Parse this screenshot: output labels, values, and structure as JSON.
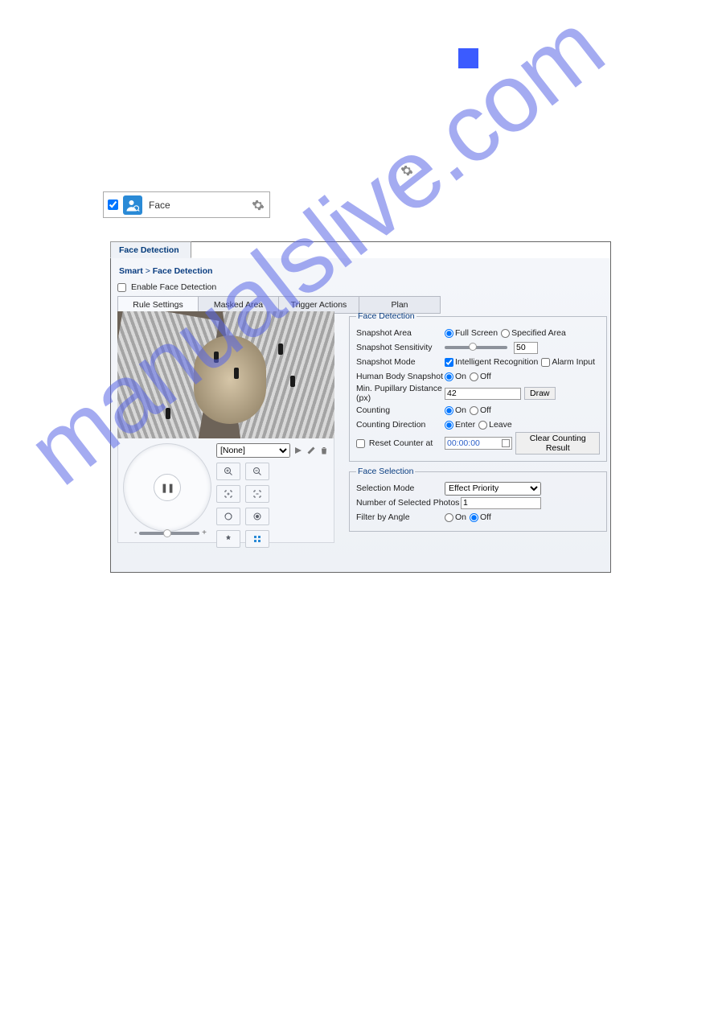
{
  "page_num_box": " ",
  "watermark": "manualslive.com",
  "face_bar": {
    "label": "Face"
  },
  "panel": {
    "tab_title": "Face Detection",
    "breadcrumb": {
      "smart": "Smart",
      "sep": ">",
      "current": "Face Detection"
    },
    "enable_label": "Enable Face Detection",
    "tabs": [
      "Rule Settings",
      "Masked Area",
      "Trigger Actions",
      "Plan"
    ]
  },
  "preset": {
    "selected": "[None]"
  },
  "zoom": {
    "minus": "-",
    "plus": "+"
  },
  "pause_glyph": "❚❚",
  "fd": {
    "legend": "Face Detection",
    "snapshot_area": {
      "label": "Snapshot Area",
      "full": "Full Screen",
      "spec": "Specified Area"
    },
    "sensitivity": {
      "label": "Snapshot Sensitivity",
      "value": "50"
    },
    "mode": {
      "label": "Snapshot Mode",
      "intel": "Intelligent Recognition",
      "alarm": "Alarm Input"
    },
    "human": {
      "label": "Human Body Snapshot",
      "on": "On",
      "off": "Off"
    },
    "pupillary": {
      "label": "Min. Pupillary Distance (px)",
      "value": "42",
      "draw": "Draw"
    },
    "counting": {
      "label": "Counting",
      "on": "On",
      "off": "Off"
    },
    "direction": {
      "label": "Counting Direction",
      "enter": "Enter",
      "leave": "Leave"
    },
    "reset": {
      "label": "Reset Counter at",
      "time": "00:00:00",
      "clear": "Clear Counting Result"
    }
  },
  "fs": {
    "legend": "Face Selection",
    "mode": {
      "label": "Selection Mode",
      "value": "Effect Priority"
    },
    "num": {
      "label": "Number of Selected Photos",
      "value": "1"
    },
    "angle": {
      "label": "Filter by Angle",
      "on": "On",
      "off": "Off"
    }
  }
}
